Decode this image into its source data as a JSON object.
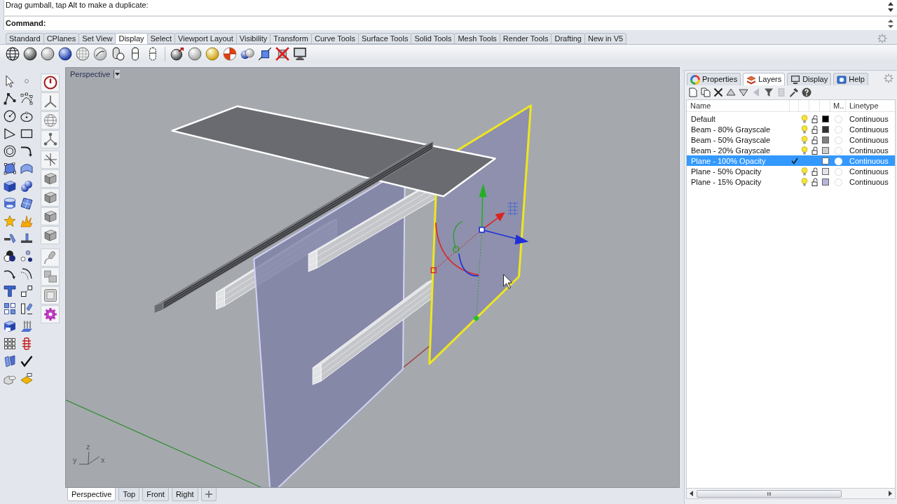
{
  "command_history": {
    "text": "Drag gumball, tap Alt to make a duplicate:"
  },
  "command_line": {
    "prompt": "Command:"
  },
  "toolbar_tabs": [
    {
      "label": "Standard",
      "selected": false
    },
    {
      "label": "CPlanes",
      "selected": false
    },
    {
      "label": "Set View",
      "selected": false
    },
    {
      "label": "Display",
      "selected": true
    },
    {
      "label": "Select",
      "selected": false
    },
    {
      "label": "Viewport Layout",
      "selected": false
    },
    {
      "label": "Visibility",
      "selected": false
    },
    {
      "label": "Transform",
      "selected": false
    },
    {
      "label": "Curve Tools",
      "selected": false
    },
    {
      "label": "Surface Tools",
      "selected": false
    },
    {
      "label": "Solid Tools",
      "selected": false
    },
    {
      "label": "Mesh Tools",
      "selected": false
    },
    {
      "label": "Render Tools",
      "selected": false
    },
    {
      "label": "Drafting",
      "selected": false
    },
    {
      "label": "New in V5",
      "selected": false
    }
  ],
  "viewport": {
    "title": "Perspective",
    "axis_labels": [
      "z",
      "y",
      "x"
    ]
  },
  "viewport_tabs": [
    {
      "label": "Perspective",
      "selected": true
    },
    {
      "label": "Top",
      "selected": false
    },
    {
      "label": "Front",
      "selected": false
    },
    {
      "label": "Right",
      "selected": false
    }
  ],
  "panel": {
    "tabs": [
      {
        "label": "Properties",
        "selected": false
      },
      {
        "label": "Layers",
        "selected": true
      },
      {
        "label": "Display",
        "selected": false
      },
      {
        "label": "Help",
        "selected": false
      }
    ],
    "columns": [
      "Name",
      "M..",
      "Linetype"
    ],
    "layers": [
      {
        "name": "Default",
        "current": false,
        "selected": false,
        "color": "#000000",
        "linetype": "Continuous"
      },
      {
        "name": "Beam - 80% Grayscale",
        "current": false,
        "selected": false,
        "color": "#333333",
        "linetype": "Continuous"
      },
      {
        "name": "Beam - 50% Grayscale",
        "current": false,
        "selected": false,
        "color": "#808080",
        "linetype": "Continuous"
      },
      {
        "name": "Beam - 20% Grayscale",
        "current": false,
        "selected": false,
        "color": "#cccccc",
        "linetype": "Continuous"
      },
      {
        "name": "Plane - 100% Opacity",
        "current": true,
        "selected": true,
        "color": "#ffffff",
        "linetype": "Continuous"
      },
      {
        "name": "Plane - 50% Opacity",
        "current": false,
        "selected": false,
        "color": "#e2e2ec",
        "linetype": "Continuous"
      },
      {
        "name": "Plane - 15% Opacity",
        "current": false,
        "selected": false,
        "color": "#b6b6da",
        "linetype": "Continuous"
      }
    ]
  }
}
